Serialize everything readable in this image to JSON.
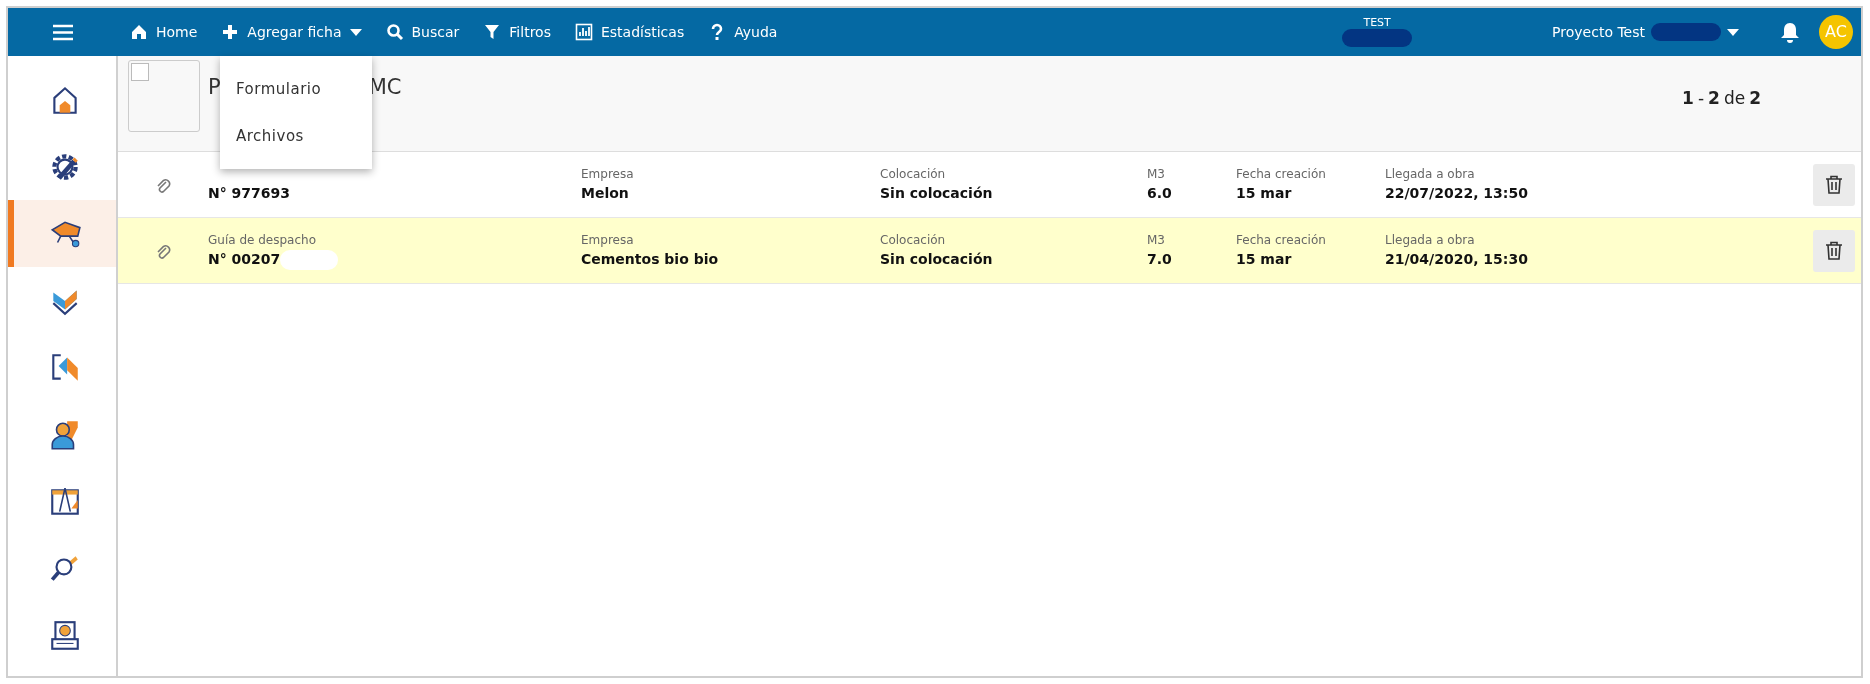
{
  "navbar": {
    "items": [
      {
        "kind": "home",
        "label": "Home"
      },
      {
        "kind": "add",
        "label": "Agregar ficha",
        "caret": true
      },
      {
        "kind": "search",
        "label": "Buscar"
      },
      {
        "kind": "filter",
        "label": "Filtros"
      },
      {
        "kind": "stats",
        "label": "Estadísticas"
      },
      {
        "kind": "help",
        "label": "Ayuda"
      }
    ],
    "env_label": "TEST",
    "project": "Proyecto Test",
    "avatar": "AC"
  },
  "dropdown": {
    "items": [
      "Formulario",
      "Archivos"
    ]
  },
  "sidebar": {
    "items": [
      {
        "kind": "home",
        "selected": false
      },
      {
        "kind": "gear",
        "selected": false
      },
      {
        "kind": "wheelbarrow",
        "selected": true
      },
      {
        "kind": "checks",
        "selected": false
      },
      {
        "kind": "transfer",
        "selected": false
      },
      {
        "kind": "person",
        "selected": false
      },
      {
        "kind": "blueprint",
        "selected": false
      },
      {
        "kind": "inspect",
        "selected": false
      },
      {
        "kind": "payment",
        "selected": false
      }
    ]
  },
  "header": {
    "select_checked": false,
    "title_start": "P",
    "title_end": "MC",
    "pagination": {
      "from": "1",
      "separator": "-",
      "to": "2",
      "of_word": "de",
      "total": "2"
    }
  },
  "rows": [
    {
      "highlighted": false,
      "fields": [
        {
          "kind": "doc",
          "value": "N° 977693"
        },
        {
          "kind": "text",
          "label": "Empresa",
          "value": "Melon"
        },
        {
          "kind": "text",
          "label": "Colocación",
          "value": "Sin colocación"
        },
        {
          "kind": "num",
          "label": "M3",
          "value": "6.0"
        },
        {
          "kind": "date",
          "label": "Fecha creación",
          "value": "15 mar"
        },
        {
          "kind": "date",
          "label": "Llegada a obra",
          "value": "22/07/2022, 13:50"
        }
      ]
    },
    {
      "highlighted": true,
      "fields": [
        {
          "kind": "doc",
          "label": "Guía de despacho",
          "value": "N° 00207"
        },
        {
          "kind": "text",
          "label": "Empresa",
          "value": "Cementos bio bio"
        },
        {
          "kind": "text",
          "label": "Colocación",
          "value": "Sin colocación"
        },
        {
          "kind": "num",
          "label": "M3",
          "value": "7.0"
        },
        {
          "kind": "date",
          "label": "Fecha creación",
          "value": "15 mar"
        },
        {
          "kind": "date",
          "label": "Llegada a obra",
          "value": "21/04/2020, 15:30"
        }
      ]
    }
  ]
}
